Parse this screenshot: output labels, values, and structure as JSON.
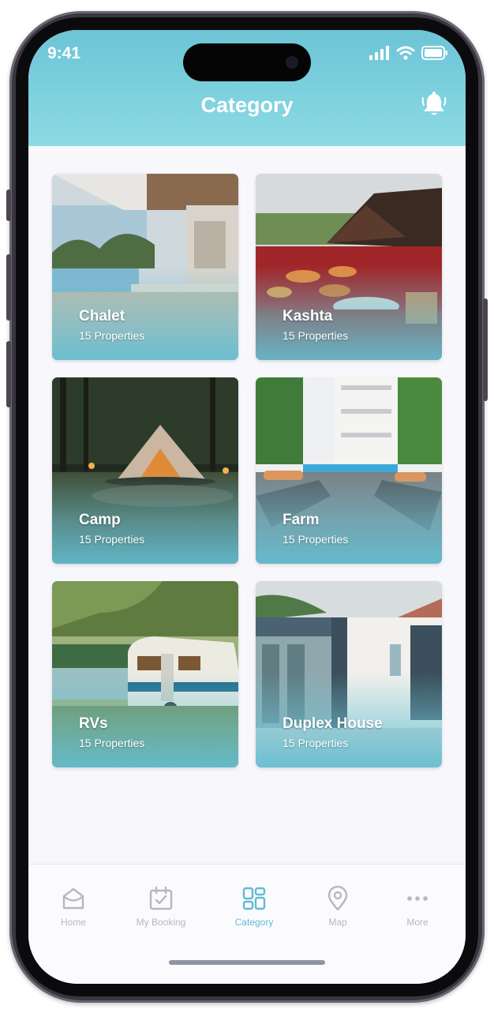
{
  "status_bar": {
    "time": "9:41"
  },
  "header": {
    "title": "Category"
  },
  "categories": [
    {
      "name": "Chalet",
      "count": "15 Properties"
    },
    {
      "name": "Kashta",
      "count": "15 Properties"
    },
    {
      "name": "Camp",
      "count": "15 Properties"
    },
    {
      "name": "Farm",
      "count": "15 Properties"
    },
    {
      "name": "RVs",
      "count": "15 Properties"
    },
    {
      "name": "Duplex House",
      "count": "15 Properties"
    }
  ],
  "tabbar": {
    "active": "Category",
    "items": [
      {
        "label": "Home",
        "icon": "home-icon"
      },
      {
        "label": "My Booking",
        "icon": "calendar-check-icon"
      },
      {
        "label": "Category",
        "icon": "grid-icon"
      },
      {
        "label": "Map",
        "icon": "map-pin-icon"
      },
      {
        "label": "More",
        "icon": "more-dots-icon"
      }
    ]
  },
  "colors": {
    "header": "#6cc4d6",
    "accent": "#5fbcd3",
    "inactive": "#b5b8c3"
  }
}
